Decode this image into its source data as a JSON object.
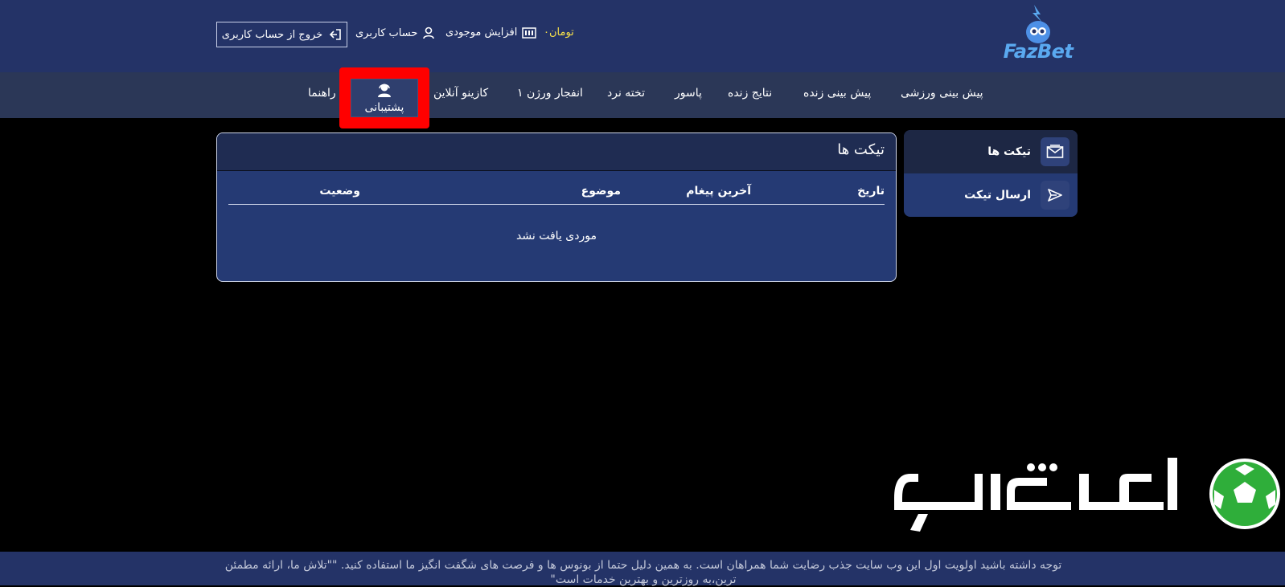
{
  "header": {
    "brand": "FazBet",
    "balance": "تومان۰",
    "deposit_label": "افزایش موجودی",
    "account_label": "حساب کاربری",
    "logout_label": "خروج از حساب کاربری"
  },
  "nav": {
    "items": [
      "پیش بینی ورزشی",
      "پیش بینی زنده",
      "نتایج زنده",
      "پاسور",
      "تخته نرد",
      "انفجار ورژن ۱",
      "کازینو آنلاین",
      "پشتیبانی",
      "راهنما"
    ],
    "active": "پشتیبانی"
  },
  "panel": {
    "title": "تیکت ها",
    "columns": [
      "تاریخ",
      "آخرین پیغام",
      "موضوع",
      "وضعیت"
    ],
    "empty_message": "موردی یافت نشد"
  },
  "side_menu": {
    "items": [
      "تیکت ها",
      "ارسال تیکت"
    ]
  },
  "footer": {
    "text": "توجه داشته باشید اولویت اول این وب سایت جذب رضایت شما همراهان است. به همین دلیل حتما از بونوس ها و فرصت های شگفت انگیز ما استفاده کنید. \"\"تلاش ما، ارائه مطمئن ترین،به روزترین و بهترین خدمات است\""
  },
  "colors": {
    "header_bg": "#243367",
    "nav_bg": "#2b3757",
    "panel_bg": "#253a74",
    "highlight": "#ff0000",
    "balance": "#f7e14a"
  }
}
